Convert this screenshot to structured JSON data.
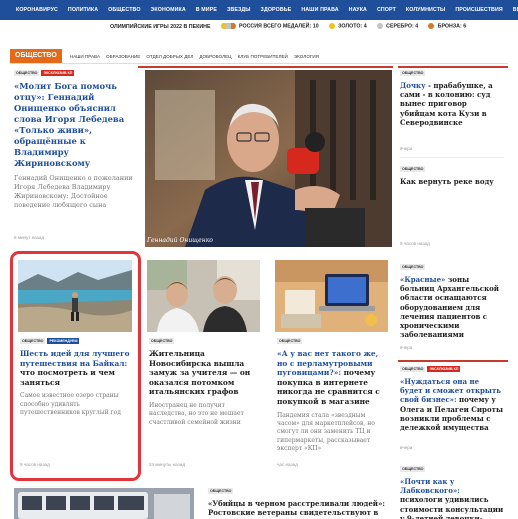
{
  "top_nav": [
    "КОРОНАВИРУС",
    "ПОЛИТИКА",
    "ОБЩЕСТВО",
    "ЭКОНОМИКА",
    "В МИРЕ",
    "ЗВЕЗДЫ",
    "ЗДОРОВЬЕ",
    "НАШИ ПРАВА",
    "НАУКА",
    "СПОРТ",
    "КОЛУМНИСТЫ",
    "ПРОИСШЕСТВИЯ",
    "ВЫБО"
  ],
  "olympics": {
    "title": "ОЛИМПИЙСКИЕ ИГРЫ 2022 В ПЕКИНЕ",
    "total_label": "РОССИЯ ВСЕГО МЕДАЛЕЙ:",
    "total": "10",
    "gold_label": "ЗОЛОТО:",
    "gold": "4",
    "silver_label": "СЕРЕБРО:",
    "silver": "4",
    "bronze_label": "БРОНЗА:",
    "bronze": "6",
    "colors": {
      "gold": "#f2c31b",
      "silver": "#c4c4c4",
      "bronze": "#d27a2f"
    }
  },
  "section": {
    "badge": "ОБЩЕСТВО",
    "items": [
      "НАШИ ПРАВА",
      "ОБРАЗОВАНИЕ",
      "ОТДЕЛ ДОБРЫХ ДЕЛ",
      "ДОБРОВОЛЕЦ",
      "КЛУБ ПОТРЕБИТЕЛЕЙ",
      "ЭКОЛОГИЯ"
    ]
  },
  "articles": {
    "main": {
      "tags": [
        "ОБЩЕСТВО",
        "ЭКСКЛЮЗИВ КП"
      ],
      "title": "«Молит Бога помочь отцу»: Геннадий Онищенко объяснил слова Игоря Лебедева «Только живи», обращённые к Владимиру Жириновскому",
      "lead": "Геннадий Онищенко о пожелании Игоря Лебедева Владимиру Жириновскому: Достойное поведение любящего сына",
      "time": "6 минут назад",
      "photo_caption": "Геннадий Онищенко"
    },
    "r1": {
      "tags": [
        "ОБЩЕСТВО"
      ],
      "title_hl": "Дочку",
      "title_rest": " - прабабушке, а сами - в колонию: суд вынес приговор убийцам кота Кузи в Северодвинске",
      "time": "вчера"
    },
    "r2": {
      "tags": [
        "ОБЩЕСТВО"
      ],
      "title": "Как вернуть реке воду",
      "time": "9 часов назад"
    },
    "r3": {
      "tags": [
        "ОБЩЕСТВО"
      ],
      "title_hl": "«Красные»",
      "title_rest": " зоны больниц Архангельской области оснащаются оборудованием для лечения пациентов с хроническими заболеваниями",
      "time": "вчера"
    },
    "baikal": {
      "tags": [
        "ОБЩЕСТВО",
        "РЕКОМЕНДУЕМ"
      ],
      "title_hl": "Шесть идей для лучшего путешествия на Байкал:",
      "title_rest": " что посмотреть и чем заняться",
      "lead": "Самое известное озеро страны способно удивлять путешественников круглый год",
      "time": "9 часов назад"
    },
    "novosib": {
      "tags": [
        "ОБЩЕСТВО"
      ],
      "title": "Жительница Новосибирска вышла замуж за учителя — он оказался потомком итальянских графов",
      "lead": "Иностранец не получит наследства, но это не мешает счастливой семейной жизни",
      "time": "24 минуты назад"
    },
    "buttons": {
      "tags": [
        "ОБЩЕСТВО"
      ],
      "title_hl": "«А у вас нет такого же, но с перламутровыми пуговицами?»:",
      "title_rest": " почему покупка в интернете никогда не сравнится с покупкой в магазине",
      "lead": "Пандемия стала «звездным часом» для маркетплейсов, но смогут ли они заменить ТЦ и гипермаркеты, рассказывает эксперт «КП»",
      "time": "час назад"
    },
    "r4": {
      "tags": [
        "ОБЩЕСТВО",
        "ЭКСКЛЮЗИВ КП"
      ],
      "title_hl": "«Нуждаться она не будет и сможет открыть свой бизнес»:",
      "title_rest": " почему у Олега и Пелагеи Сироты возникли проблемы с дележкой имущества",
      "time": "вчера"
    },
    "bottom_mid": {
      "tags": [
        "ОБЩЕСТВО"
      ],
      "title": "«Убийцы в черном расстреливали людей»: Ростовские ветераны свидетельствуют в суде"
    },
    "r5": {
      "tags": [
        "ОБЩЕСТВО"
      ],
      "title_hl": "«Почти как у Лабковского»:",
      "title_rest": " психологи удивились стоимости консультации у 9-летней девочки-психолога"
    }
  }
}
